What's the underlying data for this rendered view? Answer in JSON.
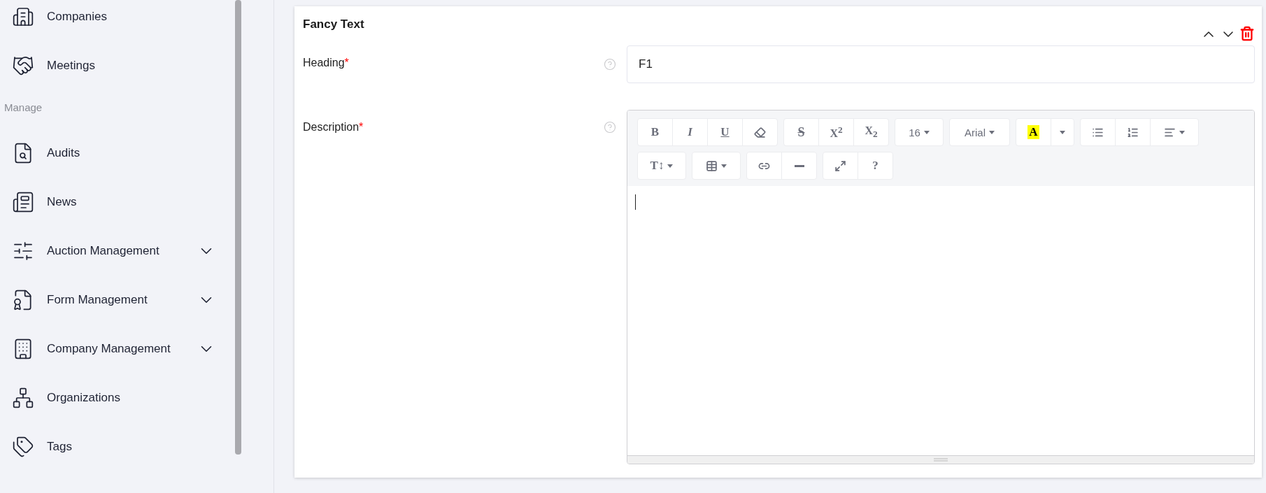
{
  "sidebar": {
    "items": [
      {
        "label": "Companies",
        "expandable": false
      },
      {
        "label": "Meetings",
        "expandable": false
      }
    ],
    "sections": [
      {
        "title": "Manage",
        "items": [
          {
            "label": "Audits",
            "expandable": false
          },
          {
            "label": "News",
            "expandable": false
          },
          {
            "label": "Auction Management",
            "expandable": true
          },
          {
            "label": "Form Management",
            "expandable": true
          },
          {
            "label": "Company Management",
            "expandable": true
          },
          {
            "label": "Organizations",
            "expandable": false
          },
          {
            "label": "Tags",
            "expandable": false
          }
        ]
      }
    ]
  },
  "card": {
    "title": "Fancy Text",
    "fields": [
      {
        "kind": "input",
        "label": "Heading",
        "marker": "*",
        "value": "F1"
      },
      {
        "kind": "editor",
        "label": "Description",
        "marker": "*",
        "toolbar": [
          [
            [
              {
                "kind": "bold",
                "label": "B"
              },
              {
                "kind": "italic",
                "label": "I"
              },
              {
                "kind": "underline",
                "label": "U"
              },
              {
                "kind": "eraser"
              }
            ],
            [
              {
                "kind": "strike",
                "label": "S"
              },
              {
                "kind": "script",
                "label": "X$^{2}$"
              },
              {
                "kind": "script",
                "label": "X$_{2}$"
              }
            ],
            [
              {
                "kind": "plain",
                "label": "16",
                "caret": true
              }
            ],
            [
              {
                "kind": "plain",
                "label": "Arial",
                "caret": true
              }
            ],
            [
              {
                "kind": "highlight",
                "label": "A"
              },
              {
                "kind": "caret"
              }
            ],
            [
              {
                "kind": "bullets"
              },
              {
                "kind": "numbers"
              },
              {
                "kind": "align",
                "caret": true
              }
            ]
          ],
          [
            [
              {
                "kind": "bold",
                "label": "T↕",
                "caret": true
              }
            ],
            [
              {
                "kind": "table",
                "caret": true
              }
            ],
            [
              {
                "kind": "link"
              },
              {
                "kind": "rule"
              }
            ],
            [
              {
                "kind": "fullscreen"
              },
              {
                "kind": "bold",
                "label": "?"
              }
            ]
          ]
        ]
      }
    ]
  }
}
